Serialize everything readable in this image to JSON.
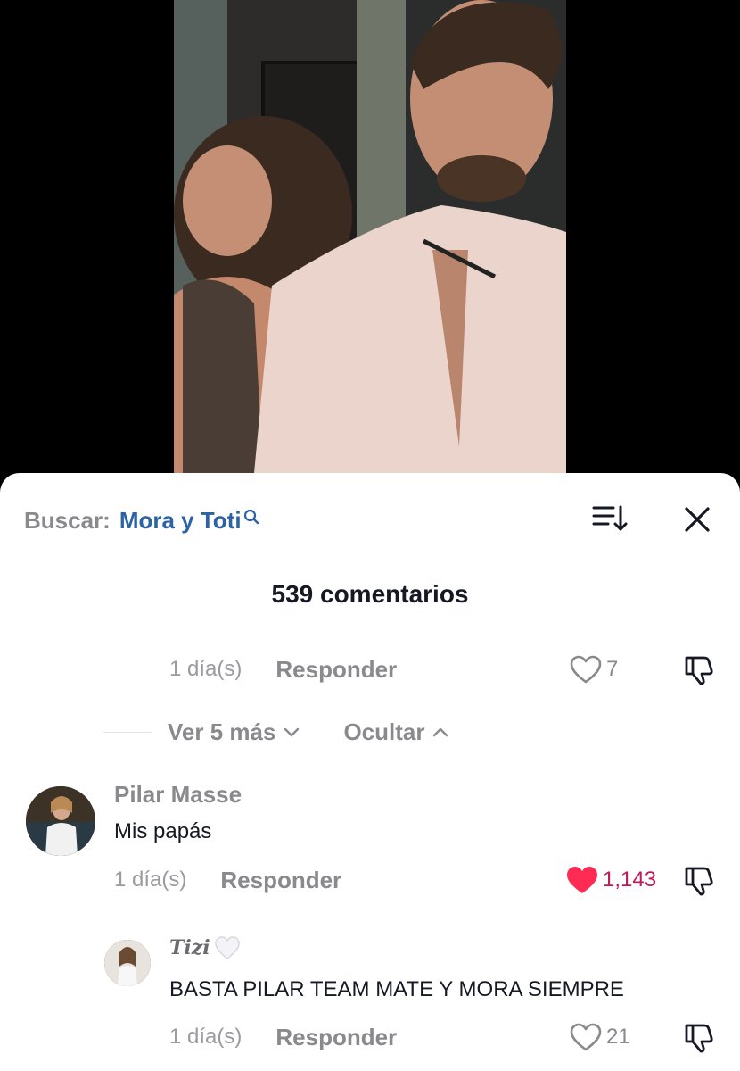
{
  "search": {
    "prefix": "Buscar:",
    "query": "Mora y Toti"
  },
  "header": {
    "comment_count": "539 comentarios"
  },
  "reply_prev": {
    "time": "1 día(s)",
    "reply_label": "Responder",
    "likes": "7"
  },
  "expand": {
    "more_label": "Ver 5 más",
    "hide_label": "Ocultar"
  },
  "comment_main": {
    "username": "Pilar Masse",
    "text": "Mis papás",
    "time": "1 día(s)",
    "reply_label": "Responder",
    "likes": "1,143",
    "liked": true
  },
  "comment_reply": {
    "username": "Tizi",
    "text": "BASTA PILAR TEAM MATE Y MORA SIEMPRE",
    "time": "1 día(s)",
    "reply_label": "Responder",
    "likes": "21"
  },
  "colors": {
    "accent_blue": "#2c63a6",
    "like_red": "#fe2c55",
    "muted_gray": "#8a8a8e"
  },
  "icons": [
    "search-icon",
    "sort-icon",
    "close-icon",
    "heart-icon",
    "dislike-icon",
    "chevron-down-icon",
    "chevron-up-icon",
    "white-heart-icon"
  ]
}
